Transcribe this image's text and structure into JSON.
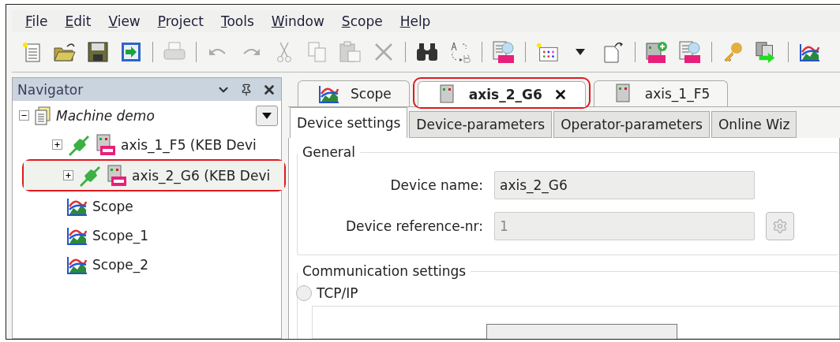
{
  "menu": [
    {
      "label": "File"
    },
    {
      "label": "Edit"
    },
    {
      "label": "View"
    },
    {
      "label": "Project"
    },
    {
      "label": "Tools"
    },
    {
      "label": "Window"
    },
    {
      "label": "Scope"
    },
    {
      "label": "Help"
    }
  ],
  "toolbar": [
    {
      "kind": "new",
      "disabled": false
    },
    {
      "kind": "open",
      "disabled": false
    },
    {
      "kind": "save",
      "disabled": false
    },
    {
      "kind": "import",
      "disabled": false
    },
    {
      "kind": "sep"
    },
    {
      "kind": "print",
      "disabled": true
    },
    {
      "kind": "sep"
    },
    {
      "kind": "undo",
      "disabled": true
    },
    {
      "kind": "redo",
      "disabled": true
    },
    {
      "kind": "cut",
      "disabled": true
    },
    {
      "kind": "copy",
      "disabled": true
    },
    {
      "kind": "paste",
      "disabled": true
    },
    {
      "kind": "delete",
      "disabled": true
    },
    {
      "kind": "sep"
    },
    {
      "kind": "find",
      "disabled": false
    },
    {
      "kind": "replace",
      "disabled": false
    },
    {
      "kind": "sep"
    },
    {
      "kind": "keb-search",
      "disabled": false
    },
    {
      "kind": "sep"
    },
    {
      "kind": "grid",
      "disabled": false
    },
    {
      "kind": "caret",
      "disabled": false
    },
    {
      "kind": "page",
      "disabled": false
    },
    {
      "kind": "sep"
    },
    {
      "kind": "keb-add",
      "disabled": false
    },
    {
      "kind": "keb-search",
      "disabled": false
    },
    {
      "kind": "sep"
    },
    {
      "kind": "key",
      "disabled": false
    },
    {
      "kind": "transfer",
      "disabled": false
    },
    {
      "kind": "sep"
    },
    {
      "kind": "scope",
      "disabled": false
    }
  ],
  "navigator": {
    "title": "Navigator",
    "tree": [
      {
        "label": "Machine demo",
        "kind": "project",
        "expanded": true,
        "selected": false,
        "annotated": false,
        "children": [
          {
            "label": "axis_1_F5 (KEB Devi",
            "kind": "device",
            "expanded": false,
            "selected": false,
            "annotated": false
          },
          {
            "label": "axis_2_G6 (KEB Devi",
            "kind": "device",
            "expanded": false,
            "selected": true,
            "annotated": true
          },
          {
            "label": "Scope",
            "kind": "scope",
            "selected": false,
            "annotated": false
          },
          {
            "label": "Scope_1",
            "kind": "scope",
            "selected": false,
            "annotated": false
          },
          {
            "label": "Scope_2",
            "kind": "scope",
            "selected": false,
            "annotated": false
          }
        ]
      }
    ]
  },
  "doc_tabs": [
    {
      "label": "Scope",
      "kind": "scope",
      "selected": false,
      "closable": false,
      "annotated": false
    },
    {
      "label": "axis_2_G6",
      "kind": "device",
      "selected": true,
      "closable": true,
      "annotated": true
    },
    {
      "label": "axis_1_F5",
      "kind": "device",
      "selected": false,
      "closable": false,
      "annotated": false
    }
  ],
  "sub_tabs": [
    {
      "label": "Device settings",
      "selected": true
    },
    {
      "label": "Device-parameters",
      "selected": false
    },
    {
      "label": "Operator-parameters",
      "selected": false
    },
    {
      "label": "Online Wiz",
      "selected": false
    }
  ],
  "general": {
    "title": "General",
    "fields": [
      {
        "label": "Device name:",
        "value": "axis_2_G6",
        "disabled": false,
        "has_button": false
      },
      {
        "label": "Device reference-nr:",
        "value": "1",
        "disabled": true,
        "has_button": true
      }
    ]
  },
  "communication": {
    "title": "Communication settings",
    "options": [
      {
        "label": "TCP/IP",
        "selected": false
      }
    ]
  }
}
